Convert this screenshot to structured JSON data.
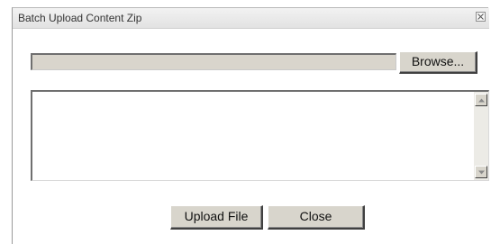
{
  "dialog": {
    "title": "Batch Upload Content Zip",
    "close_icon": "close-icon"
  },
  "file_input": {
    "value": "",
    "browse_label": "Browse..."
  },
  "output_area": {
    "value": "",
    "scroll_up_icon": "arrow-up-icon",
    "scroll_down_icon": "arrow-down-icon"
  },
  "actions": {
    "upload_label": "Upload File",
    "close_label": "Close"
  },
  "colors": {
    "button_face": "#d8d5cc",
    "field_background": "#d9d5cc",
    "titlebar": "#e8e8e8"
  }
}
